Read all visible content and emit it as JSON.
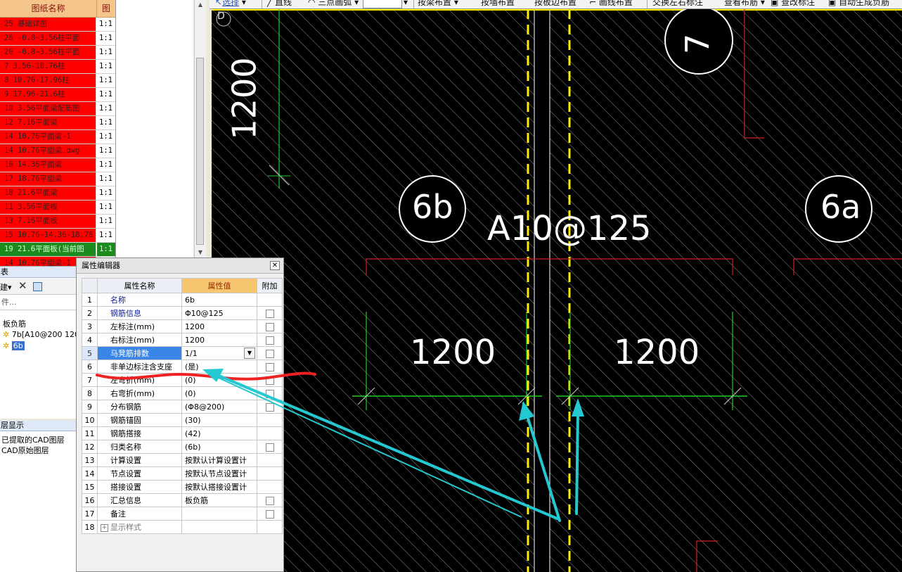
{
  "drawing_list": {
    "header_name": "图纸名称",
    "header_scale": "图",
    "rows": [
      {
        "name": "25 基础详图",
        "scale": "1:1"
      },
      {
        "name": "26 -0.8~3.56柱平面",
        "scale": "1:1"
      },
      {
        "name": "26 -0.8~3.56柱平面",
        "scale": "1:1"
      },
      {
        "name": "7 3.56-10.76柱",
        "scale": "1:1"
      },
      {
        "name": "8 10.76-17.96柱",
        "scale": "1:1"
      },
      {
        "name": "9 17.96-21.6柱",
        "scale": "1:1"
      },
      {
        "name": "10 3.56平面梁配筋图",
        "scale": "1:1"
      },
      {
        "name": "12 7.16平面梁",
        "scale": "1:1"
      },
      {
        "name": "14 10.76平面梁-1",
        "scale": "1:1"
      },
      {
        "name": "14 10.76平面梁.dwg",
        "scale": "1:1"
      },
      {
        "name": "16 14.36平面梁",
        "scale": "1:1"
      },
      {
        "name": "17 18.76平面梁",
        "scale": "1:1"
      },
      {
        "name": "18 21.6平面梁",
        "scale": "1:1"
      },
      {
        "name": "11 3.56平面板",
        "scale": "1:1"
      },
      {
        "name": "13 7.16平面板",
        "scale": "1:1"
      },
      {
        "name": "15 10.76-14.36-18.76",
        "scale": "1:1"
      },
      {
        "name": "19 21.6平面板(当前图",
        "scale": "1:1",
        "current": true
      },
      {
        "name": "14 10.76平面梁-1",
        "scale": "1:1"
      }
    ]
  },
  "component_panel": {
    "title": "表",
    "new_label": "建",
    "search_placeholder": "件...",
    "tree_root": "板负筋",
    "items": [
      "7b[A10@200 120",
      "6b"
    ]
  },
  "layer_panel": {
    "title": "层显示",
    "items": [
      "已提取的CAD图层",
      "CAD原始图层"
    ]
  },
  "toolbar": {
    "items": [
      "选择",
      "直线",
      "三点画弧",
      "按梁布置",
      "按墙布置",
      "按板边布置",
      "画线布置",
      "交换左右标注",
      "查看布筋",
      "查改标注",
      "自动生成负筋"
    ]
  },
  "canvas": {
    "axis_label": "D",
    "axis_bubbles": [
      "7",
      "6b",
      "6a"
    ],
    "rebar_label": "A10@125",
    "dims": {
      "vertical": "1200",
      "left": "1200",
      "right": "1200"
    }
  },
  "property_editor": {
    "title": "属性编辑器",
    "columns": {
      "name": "属性名称",
      "value": "属性值",
      "extra": "附加"
    },
    "rows": [
      {
        "idx": "1",
        "name": "名称",
        "value": "6b",
        "style": "blue",
        "checkbox": false
      },
      {
        "idx": "2",
        "name": "钢筋信息",
        "value": "Φ10@125",
        "style": "blue",
        "checkbox": true
      },
      {
        "idx": "3",
        "name": "左标注(mm)",
        "value": "1200",
        "style": "",
        "checkbox": true
      },
      {
        "idx": "4",
        "name": "右标注(mm)",
        "value": "1200",
        "style": "",
        "checkbox": true
      },
      {
        "idx": "5",
        "name": "马凳筋排数",
        "value": "1/1",
        "style": "selected",
        "checkbox": true,
        "dropdown": true
      },
      {
        "idx": "6",
        "name": "非单边标注含支座",
        "value": "(是)",
        "style": "",
        "checkbox": true
      },
      {
        "idx": "7",
        "name": "左弯折(mm)",
        "value": "(0)",
        "style": "",
        "checkbox": true
      },
      {
        "idx": "8",
        "name": "右弯折(mm)",
        "value": "(0)",
        "style": "",
        "checkbox": true
      },
      {
        "idx": "9",
        "name": "分布钢筋",
        "value": "(Φ8@200)",
        "style": "",
        "checkbox": true
      },
      {
        "idx": "10",
        "name": "钢筋锚固",
        "value": "(30)",
        "style": "",
        "checkbox": false
      },
      {
        "idx": "11",
        "name": "钢筋搭接",
        "value": "(42)",
        "style": "",
        "checkbox": false
      },
      {
        "idx": "12",
        "name": "归类名称",
        "value": "(6b)",
        "style": "",
        "checkbox": true
      },
      {
        "idx": "13",
        "name": "计算设置",
        "value": "按默认计算设置计",
        "style": "",
        "checkbox": false
      },
      {
        "idx": "14",
        "name": "节点设置",
        "value": "按默认节点设置计",
        "style": "",
        "checkbox": false
      },
      {
        "idx": "15",
        "name": "搭接设置",
        "value": "按默认搭接设置计",
        "style": "",
        "checkbox": false
      },
      {
        "idx": "16",
        "name": "汇总信息",
        "value": "板负筋",
        "style": "",
        "checkbox": true
      },
      {
        "idx": "17",
        "name": "备注",
        "value": "",
        "style": "",
        "checkbox": true
      },
      {
        "idx": "18",
        "name": "显示样式",
        "value": "",
        "style": "gray",
        "checkbox": false,
        "expander": true
      }
    ]
  },
  "colors": {
    "canvas_bg": "#000000",
    "hatch": "#9a9a9a",
    "green_dim": "#22cc22",
    "yellow_dash": "#ffee00",
    "red_outline": "#d02020",
    "cyan_arrow": "#23c8d0",
    "red_mark": "#ee2222"
  }
}
